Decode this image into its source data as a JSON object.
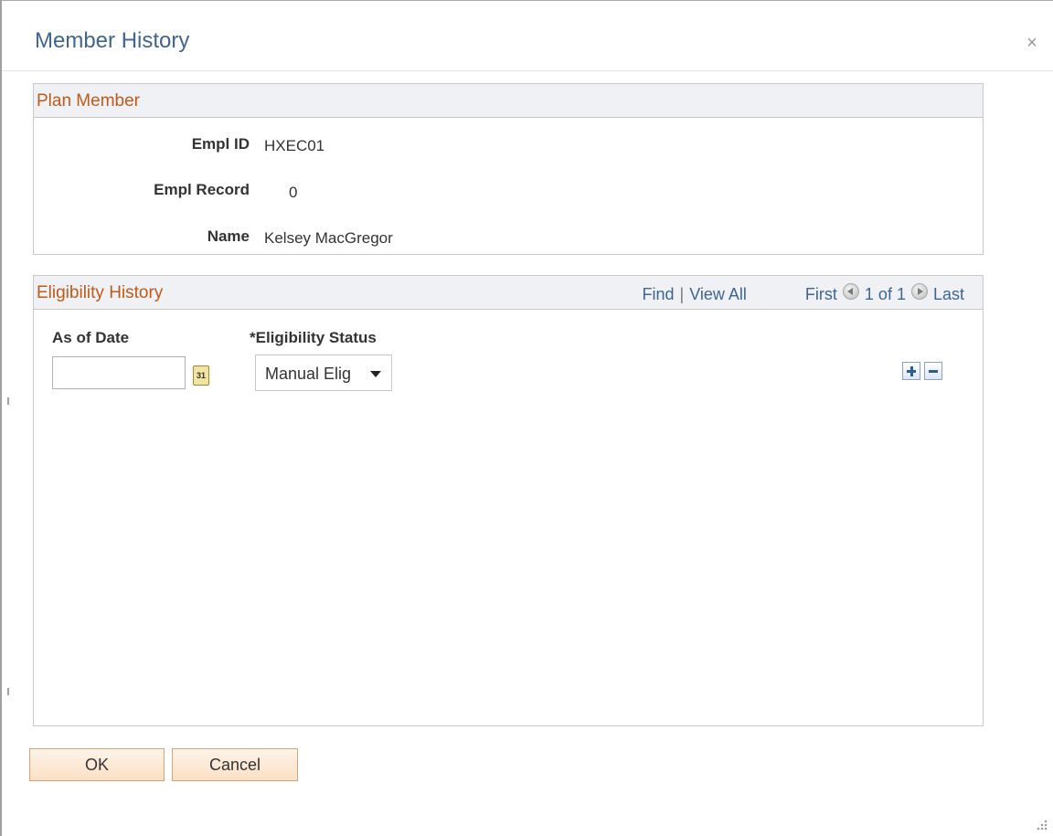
{
  "dialog": {
    "title": "Member History",
    "close_glyph": "×"
  },
  "plan_member": {
    "section_title": "Plan Member",
    "fields": [
      {
        "label": "Empl ID",
        "value": "HXEC01"
      },
      {
        "label": "Empl Record",
        "value": "0"
      },
      {
        "label": "Name",
        "value": "Kelsey MacGregor"
      }
    ]
  },
  "eligibility_history": {
    "section_title": "Eligibility History",
    "nav": {
      "find": "Find",
      "separator": "|",
      "view_all": "View All",
      "first": "First",
      "counter": "1 of 1",
      "last": "Last",
      "prev_icon": "previous-arrow-icon",
      "next_icon": "next-arrow-icon"
    },
    "columns": {
      "as_of_date": "As of Date",
      "eligibility_status": "*Eligibility Status"
    },
    "row": {
      "as_of_date_value": "",
      "calendar_glyph": "31",
      "status_value": "Manual Elig"
    },
    "add_row_icon": "plus-icon",
    "delete_row_icon": "minus-icon"
  },
  "buttons": {
    "ok": "OK",
    "cancel": "Cancel"
  },
  "colors": {
    "title_blue": "#3f6592",
    "section_orange": "#c05a1a",
    "header_bg": "#eff1f4",
    "button_bg": "#fbe0c6",
    "button_border": "#d9a37a"
  }
}
